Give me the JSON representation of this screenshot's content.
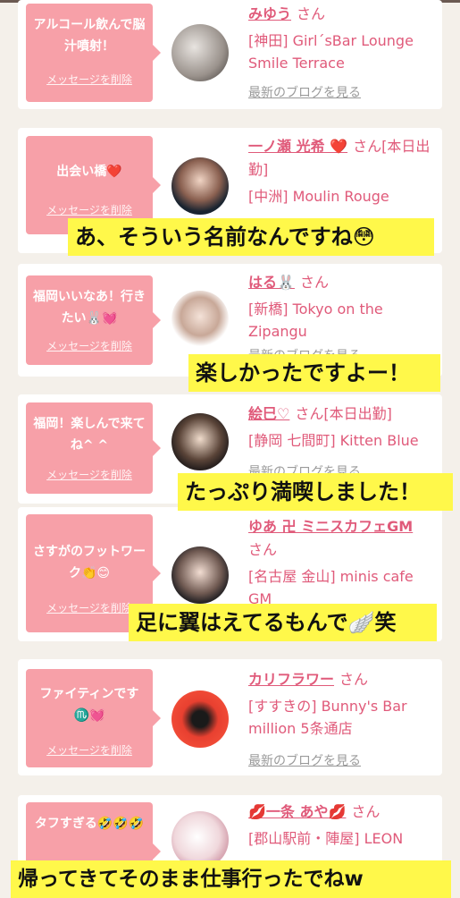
{
  "delete_label": "メッセージを削除",
  "blog_label": "最新のブログを見る",
  "san": "さん",
  "cards": [
    {
      "message": "アルコール飲んで脳汁噴射！",
      "name": "みゆう",
      "name_suffix": "",
      "shop": "[神田] Girl´sBar Lounge Smile Terrace"
    },
    {
      "message": "出会い橋❤️",
      "name": "一ノ瀬 光希 ❤️",
      "name_suffix": "[本日出勤]",
      "shop": "[中洲] Moulin Rouge"
    },
    {
      "message": "福岡いいなあ！行きたい🐰💓",
      "name": "はる🐰",
      "name_suffix": "",
      "shop": "[新橋] Tokyo on the Zipangu"
    },
    {
      "message": "福岡！楽しんで来てね^ ^",
      "name": "絵巳♡",
      "name_suffix": "[本日出勤]",
      "shop": "[静岡 七間町] Kitten Blue"
    },
    {
      "message": "さすがのフットワーク👏😊",
      "name": "ゆあ 卍 ミニスカフェGM",
      "name_suffix": "",
      "shop": "[名古屋 金山] minis cafe GM"
    },
    {
      "message": "ファイティンです♏️💓",
      "name": "カリフラワー",
      "name_suffix": "",
      "shop": "[すすきの] Bunny's Bar million 5条通店"
    },
    {
      "message": "タフすぎる🤣🤣🤣",
      "name": "💋一条 あや💋",
      "name_suffix": "",
      "shop": "[郡山駅前・陣屋] LEON"
    }
  ],
  "captions": [
    "あ、そういう名前なんですね😳",
    "楽しかったですよー！",
    "たっぷり満喫しました！",
    "足に翼はえてるもんで🪽笑",
    "帰ってきてそのまま仕事行ったでねw"
  ]
}
